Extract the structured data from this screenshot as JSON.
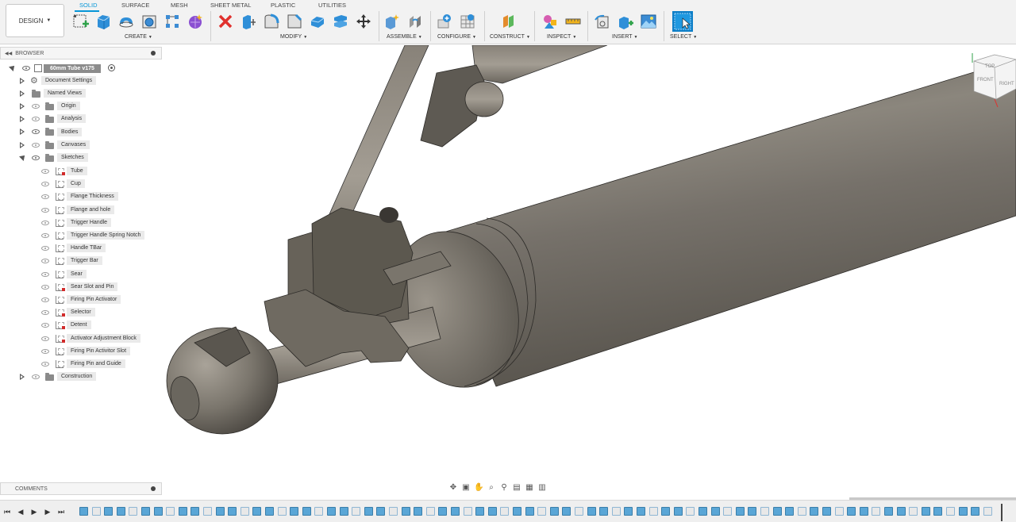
{
  "workspace": {
    "label": "DESIGN"
  },
  "tabs": [
    {
      "label": "SOLID",
      "active": true
    },
    {
      "label": "SURFACE",
      "active": false
    },
    {
      "label": "MESH",
      "active": false
    },
    {
      "label": "SHEET METAL",
      "active": false
    },
    {
      "label": "PLASTIC",
      "active": false
    },
    {
      "label": "UTILITIES",
      "active": false
    }
  ],
  "groups": [
    {
      "label": "CREATE"
    },
    {
      "label": "MODIFY"
    },
    {
      "label": "ASSEMBLE"
    },
    {
      "label": "CONFIGURE"
    },
    {
      "label": "CONSTRUCT"
    },
    {
      "label": "INSPECT"
    },
    {
      "label": "INSERT"
    },
    {
      "label": "SELECT"
    }
  ],
  "browser": {
    "title": "BROWSER",
    "root": "60mm Tube v175",
    "folders": [
      {
        "label": "Document Settings",
        "icon": "gear-icon"
      },
      {
        "label": "Named Views",
        "icon": "folder-icon"
      },
      {
        "label": "Origin",
        "icon": "folder-icon"
      },
      {
        "label": "Analysis",
        "icon": "folder-icon"
      },
      {
        "label": "Bodies",
        "icon": "folder-icon"
      },
      {
        "label": "Canvases",
        "icon": "folder-icon"
      },
      {
        "label": "Sketches",
        "icon": "folder-icon"
      }
    ],
    "sketches": [
      {
        "label": "Tube",
        "warn": true
      },
      {
        "label": "Cup",
        "warn": false
      },
      {
        "label": "Flange Thickness",
        "warn": false
      },
      {
        "label": "Flange and hole",
        "warn": false
      },
      {
        "label": "Trigger Handle",
        "warn": false
      },
      {
        "label": "Trigger Handle Spring Notch",
        "warn": false
      },
      {
        "label": "Handle TBar",
        "warn": false
      },
      {
        "label": "Trigger Bar",
        "warn": false
      },
      {
        "label": "Sear",
        "warn": false
      },
      {
        "label": "Sear Slot and Pin",
        "warn": true
      },
      {
        "label": "Firing Pin Activator",
        "warn": false
      },
      {
        "label": "Selector",
        "warn": true
      },
      {
        "label": "Detent",
        "warn": true
      },
      {
        "label": "Activator Adjustment Block",
        "warn": true
      },
      {
        "label": "Firing Pin Activitor Slot",
        "warn": false
      },
      {
        "label": "Firing Pin and Guide",
        "warn": false
      }
    ],
    "construction": "Construction"
  },
  "viewcube": {
    "top": "TOP",
    "front": "FRONT",
    "right": "RIGHT"
  },
  "comments": {
    "label": "COMMENTS"
  },
  "colors": {
    "accent": "#0696d7",
    "delete": "#e0302d",
    "model": "#6e6a63"
  }
}
